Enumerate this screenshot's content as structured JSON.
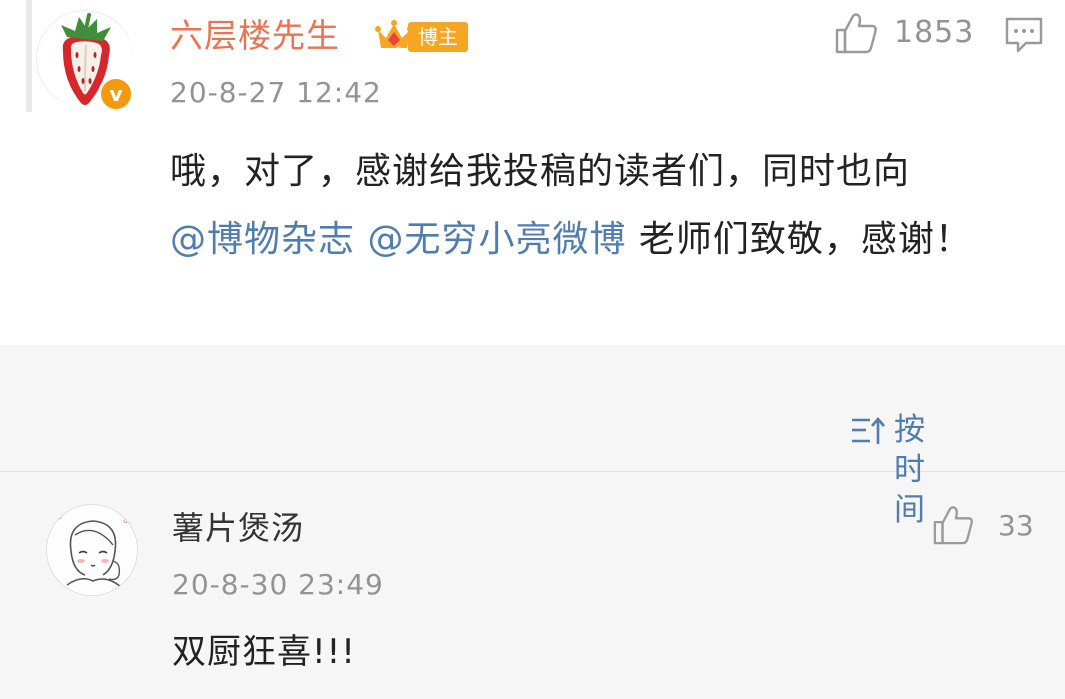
{
  "post": {
    "author_name": "六层楼先生",
    "author_badge": "博主",
    "verified_mark": "v",
    "time": "20-8-27 12:42",
    "like_count": "1853",
    "text_segments": [
      {
        "type": "text",
        "value": "哦，对了，感谢给我投稿的读者们，同时也向"
      },
      {
        "type": "mention",
        "value": "@博物杂志 @无穷小亮微博"
      },
      {
        "type": "text",
        "value": " 老师们致敬，感谢！"
      }
    ],
    "icons": {
      "avatar": "strawberry-avatar",
      "verified": "verified-badge-icon",
      "crown": "crown-icon",
      "like": "thumbs-up-icon",
      "comment": "comment-icon"
    }
  },
  "sort": {
    "label": "按时间",
    "icon": "sort-icon"
  },
  "comment": {
    "author_name": "薯片煲汤",
    "time": "20-8-30 23:49",
    "text": "双厨狂喜!!!",
    "like_count": "33",
    "icons": {
      "avatar": "sketch-girl-avatar",
      "like": "thumbs-up-icon"
    }
  },
  "colors": {
    "name_orange": "#eb7350",
    "link_blue": "#507daf",
    "meta_gray": "#939393",
    "badge_orange": "#f6a623",
    "background": "#f6f6f6"
  }
}
